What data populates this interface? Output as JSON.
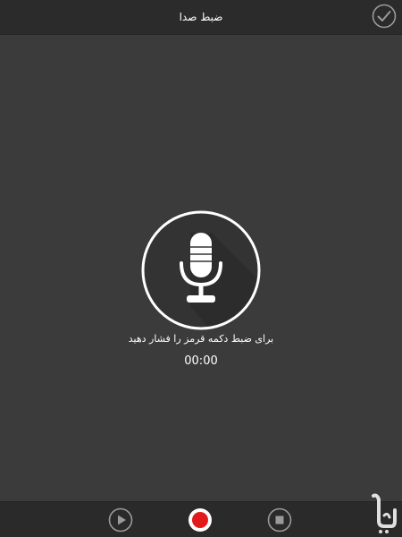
{
  "header": {
    "title": "ضبط صدا",
    "confirm_icon": "checkmark-circle-icon"
  },
  "recorder": {
    "mic_icon": "microphone-icon",
    "instruction": "برای ضبط دکمه قرمز را فشار دهید",
    "timer": "00:00"
  },
  "controls": {
    "play_icon": "play-icon",
    "record_icon": "record-icon",
    "stop_icon": "stop-icon"
  },
  "colors": {
    "background": "#3b3b3b",
    "bar": "#2a2a2a",
    "record_red": "#e11b1b",
    "icon_gray": "#9a9a9a"
  }
}
